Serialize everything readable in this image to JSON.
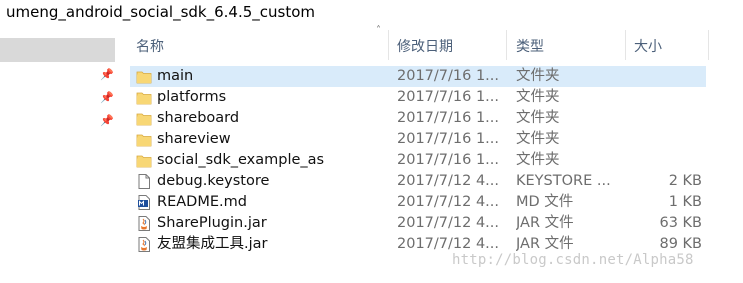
{
  "window": {
    "title": "umeng_android_social_sdk_6.4.5_custom"
  },
  "columns": {
    "name": "名称",
    "date_modified": "修改日期",
    "type": "类型",
    "size": "大小"
  },
  "files": [
    {
      "name": "main",
      "date": "2017/7/16 1...",
      "type": "文件夹",
      "size": "",
      "icon": "folder-icon",
      "selected": true
    },
    {
      "name": "platforms",
      "date": "2017/7/16 1...",
      "type": "文件夹",
      "size": "",
      "icon": "folder-icon",
      "selected": false
    },
    {
      "name": "shareboard",
      "date": "2017/7/16 1...",
      "type": "文件夹",
      "size": "",
      "icon": "folder-icon",
      "selected": false
    },
    {
      "name": "shareview",
      "date": "2017/7/16 1...",
      "type": "文件夹",
      "size": "",
      "icon": "folder-icon",
      "selected": false
    },
    {
      "name": "social_sdk_example_as",
      "date": "2017/7/16 1...",
      "type": "文件夹",
      "size": "",
      "icon": "folder-icon",
      "selected": false
    },
    {
      "name": "debug.keystore",
      "date": "2017/7/12 4...",
      "type": "KEYSTORE ...",
      "size": "2 KB",
      "icon": "file-icon",
      "selected": false
    },
    {
      "name": "README.md",
      "date": "2017/7/12 4...",
      "type": "MD 文件",
      "size": "1 KB",
      "icon": "md-file-icon",
      "selected": false
    },
    {
      "name": "SharePlugin.jar",
      "date": "2017/7/12 4...",
      "type": "JAR 文件",
      "size": "63 KB",
      "icon": "java-jar-icon",
      "selected": false
    },
    {
      "name": "友盟集成工具.jar",
      "date": "2017/7/12 4...",
      "type": "JAR 文件",
      "size": "89 KB",
      "icon": "java-jar-icon",
      "selected": false
    }
  ],
  "watermark": "http://blog.csdn.net/Alpha58",
  "colors": {
    "selection": "#d9ebfa",
    "folder": "#f8d775",
    "header_text": "#4c607a"
  }
}
